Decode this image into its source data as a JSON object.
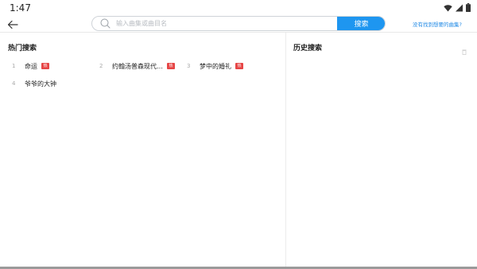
{
  "status_bar": {
    "time": "1:47",
    "icons": [
      "wifi-icon",
      "signal-icon",
      "battery-icon"
    ]
  },
  "header": {
    "search_placeholder": "输入曲集或曲目名",
    "search_button": "搜索",
    "missing_link": "没有找到想要的曲集?"
  },
  "hot_search": {
    "title": "热门搜索",
    "items": [
      {
        "rank": "1",
        "name": "命运",
        "badge": "热"
      },
      {
        "rank": "2",
        "name": "约翰汤普森现代…",
        "badge": "热"
      },
      {
        "rank": "3",
        "name": "梦中的婚礼",
        "badge": "热"
      },
      {
        "rank": "4",
        "name": "爷爷的大钟",
        "badge": ""
      }
    ]
  },
  "history_search": {
    "title": "历史搜索"
  },
  "colors": {
    "accent": "#1e96f0",
    "badge": "#e64545",
    "link": "#1e88e5"
  }
}
